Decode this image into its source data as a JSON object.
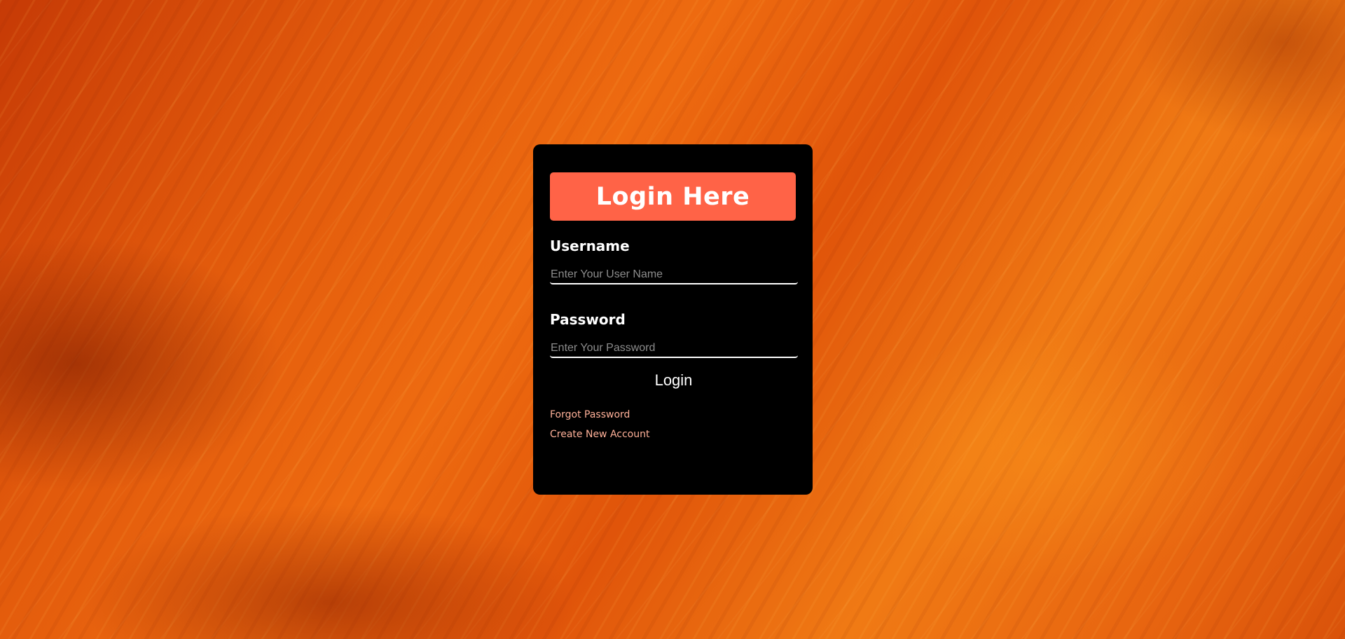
{
  "form": {
    "title": "Login Here",
    "username": {
      "label": "Username",
      "placeholder": "Enter Your User Name",
      "value": ""
    },
    "password": {
      "label": "Password",
      "placeholder": "Enter Your Password",
      "value": ""
    },
    "submit_label": "Login",
    "links": {
      "forgot_password": "Forgot Password",
      "create_account": "Create New Account"
    }
  },
  "colors": {
    "card_background": "#000000",
    "title_bar": "#ff6347",
    "link": "#ffb199",
    "page_background": "#e8620c"
  }
}
